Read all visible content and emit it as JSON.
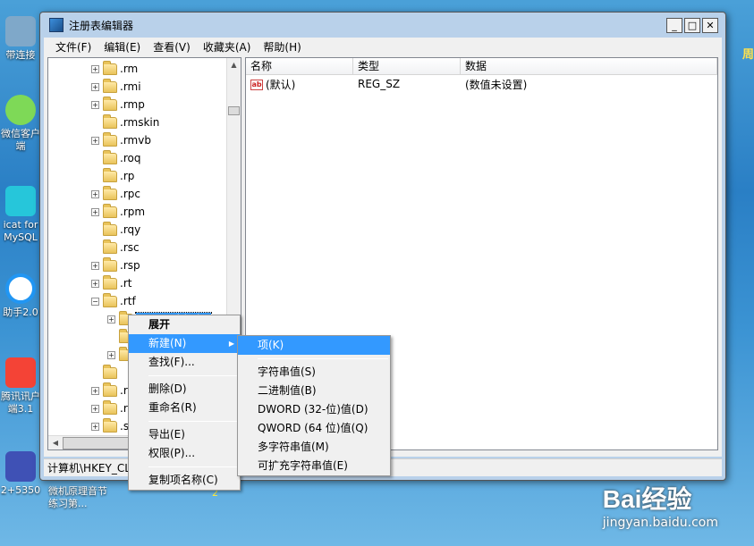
{
  "window": {
    "title": "注册表编辑器",
    "btn_min": "_",
    "btn_max": "□",
    "btn_close": "✕"
  },
  "menubar": [
    "文件(F)",
    "编辑(E)",
    "查看(V)",
    "收藏夹(A)",
    "帮助(H)"
  ],
  "tree": {
    "rows": [
      {
        "label": ".rm",
        "expander": "+",
        "level": 0
      },
      {
        "label": ".rmi",
        "expander": "+",
        "level": 0
      },
      {
        "label": ".rmp",
        "expander": "+",
        "level": 0
      },
      {
        "label": ".rmskin",
        "expander": "",
        "level": 0
      },
      {
        "label": ".rmvb",
        "expander": "+",
        "level": 0
      },
      {
        "label": ".roq",
        "expander": "",
        "level": 0
      },
      {
        "label": ".rp",
        "expander": "",
        "level": 0
      },
      {
        "label": ".rpc",
        "expander": "+",
        "level": 0
      },
      {
        "label": ".rpm",
        "expander": "+",
        "level": 0
      },
      {
        "label": ".rqy",
        "expander": "",
        "level": 0
      },
      {
        "label": ".rsc",
        "expander": "",
        "level": 0
      },
      {
        "label": ".rsp",
        "expander": "+",
        "level": 0
      },
      {
        "label": ".rt",
        "expander": "+",
        "level": 0
      },
      {
        "label": ".rtf",
        "expander": "−",
        "level": 0
      },
      {
        "label": "OpenWithList",
        "expander": "+",
        "level": 1,
        "selected": true
      },
      {
        "label": "",
        "expander": "",
        "level": 1
      },
      {
        "label": "",
        "expander": "+",
        "level": 1
      },
      {
        "label": "",
        "expander": "",
        "level": 0
      },
      {
        "label": ".r",
        "expander": "+",
        "level": 0
      },
      {
        "label": ".r",
        "expander": "+",
        "level": 0
      },
      {
        "label": ".s",
        "expander": "+",
        "level": 0
      },
      {
        "label": ".s",
        "expander": "+",
        "level": 0
      }
    ]
  },
  "list": {
    "columns": [
      "名称",
      "类型",
      "数据"
    ],
    "rows": [
      {
        "icon": "ab",
        "name": "(默认)",
        "type": "REG_SZ",
        "data": "(数值未设置)"
      }
    ]
  },
  "statusbar": {
    "path": "计算机\\HKEY_CLASSES_ROOT\\.rtf\\OpenWithList"
  },
  "context_menu": {
    "items": [
      {
        "label": "展开",
        "bold": true
      },
      {
        "label": "新建(N)",
        "submenu": true,
        "highlight": true
      },
      {
        "label": "查找(F)..."
      },
      {
        "sep": true
      },
      {
        "label": "删除(D)"
      },
      {
        "label": "重命名(R)"
      },
      {
        "sep": true
      },
      {
        "label": "导出(E)"
      },
      {
        "label": "权限(P)..."
      },
      {
        "sep": true
      },
      {
        "label": "复制项名称(C)"
      }
    ]
  },
  "submenu": {
    "items": [
      {
        "label": "项(K)",
        "highlight": true
      },
      {
        "sep": true
      },
      {
        "label": "字符串值(S)"
      },
      {
        "label": "二进制值(B)"
      },
      {
        "label": "DWORD (32-位)值(D)"
      },
      {
        "label": "QWORD (64 位)值(Q)"
      },
      {
        "label": "多字符串值(M)"
      },
      {
        "label": "可扩充字符串值(E)"
      }
    ]
  },
  "desktop": {
    "icons": [
      "带连接",
      "微信客户端",
      "icat for MySQL",
      "助手2.0",
      "腾讯讯户端3.1",
      "2+5350"
    ],
    "right_label": "周",
    "bottom_labels": [
      "微机原理音节练习第...",
      "2"
    ],
    "watermark_big": "Bai经验",
    "watermark_small": "jingyan.baidu.com"
  },
  "colors": {
    "selection": "#3399ff",
    "window_frame": "#b9d1ea"
  }
}
